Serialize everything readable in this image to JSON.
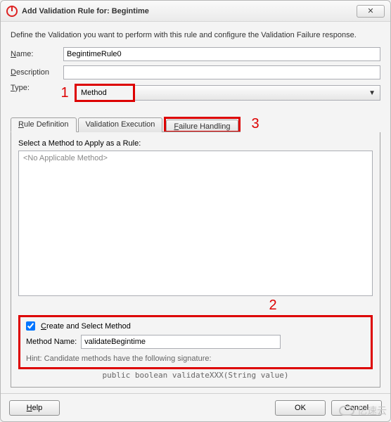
{
  "window": {
    "title": "Add Validation Rule for: Begintime",
    "close_glyph": "✕"
  },
  "intro": "Define the Validation you want to perform with this rule and configure the Validation Failure response.",
  "form": {
    "name_label_pre": "N",
    "name_label_post": "ame:",
    "name_value": "BegintimeRule0",
    "desc_label_pre": "D",
    "desc_label_post": "escription",
    "desc_value": "",
    "type_label_pre": "T",
    "type_label_post": "ype:",
    "type_value": "Method"
  },
  "annotations": {
    "one": "1",
    "two": "2",
    "three": "3"
  },
  "tabs": {
    "rule_def_pre": "R",
    "rule_def_post": "ule Definition",
    "val_exec": "Validation Execution",
    "fail_pre": "F",
    "fail_post": "ailure Handling"
  },
  "panel": {
    "select_label": "Select a Method to Apply as a Rule:",
    "no_method": "<No Applicable Method>",
    "create_pre": "C",
    "create_post": "reate and Select Method",
    "create_checked": true,
    "method_name_label": "Method Name:",
    "method_name_value": "validateBegintime",
    "hint": "Hint: Candidate methods have the following signature:",
    "signature": "public boolean validateXXX(String value)"
  },
  "buttons": {
    "help_pre": "H",
    "help_post": "elp",
    "ok": "OK",
    "cancel": "Cancel"
  },
  "watermark": "亿速云"
}
